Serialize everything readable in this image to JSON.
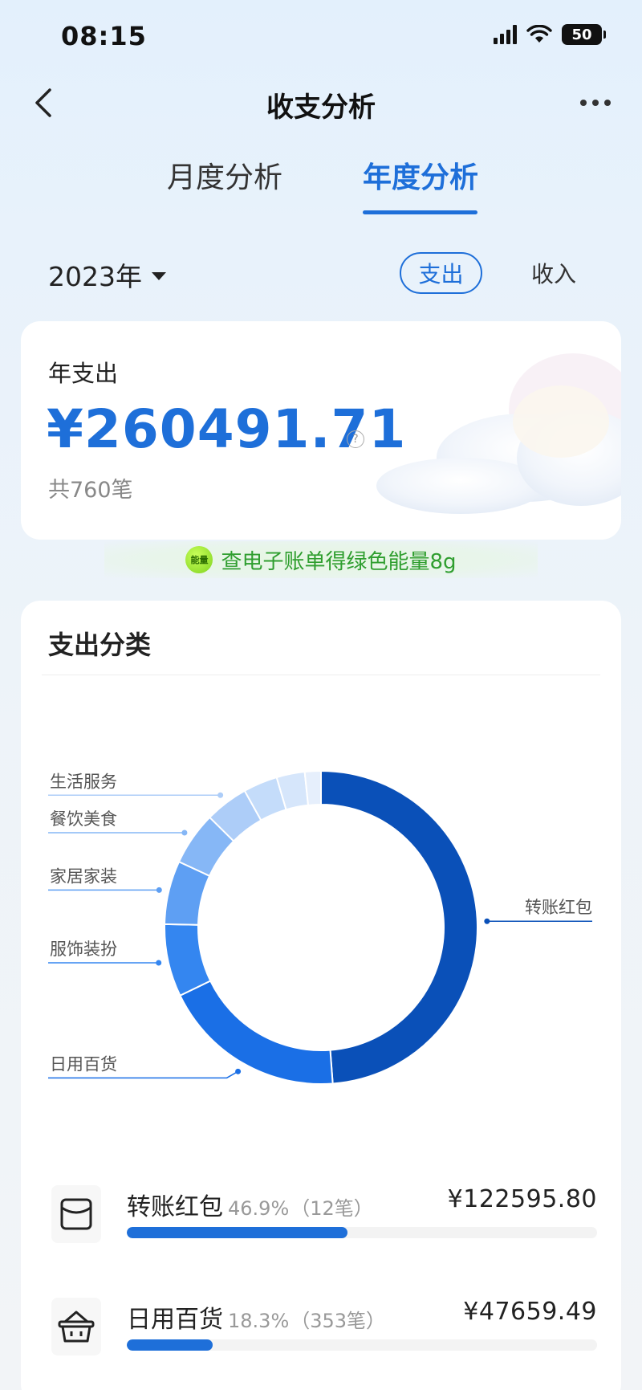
{
  "status": {
    "time": "08:15",
    "battery": "50"
  },
  "nav": {
    "title": "收支分析"
  },
  "tabs": {
    "month": "月度分析",
    "year": "年度分析"
  },
  "filter": {
    "year": "2023年",
    "expense": "支出",
    "income": "收入"
  },
  "summary": {
    "label": "年支出",
    "amount": "¥260491.71",
    "count": "共760笔",
    "help_icon": "question-circle-icon"
  },
  "energy": {
    "badge": "能量",
    "text": "查电子账单得绿色能量8g"
  },
  "category": {
    "title": "支出分类"
  },
  "chart_data": {
    "type": "pie",
    "variant": "donut",
    "title": "",
    "slices": [
      {
        "label": "转账红包",
        "value": 46.9,
        "color": "#0a50b8",
        "labeled": true
      },
      {
        "label": "日用百货",
        "value": 18.3,
        "color": "#1a6fe6",
        "labeled": true
      },
      {
        "label": "服饰装扮",
        "value": 7.2,
        "color": "#3486f0",
        "labeled": true
      },
      {
        "label": "家居家装",
        "value": 6.3,
        "color": "#5e9ff3",
        "labeled": true
      },
      {
        "label": "餐饮美食",
        "value": 5.3,
        "color": "#86b7f6",
        "labeled": true
      },
      {
        "label": "生活服务",
        "value": 4.3,
        "color": "#adcdf8",
        "labeled": true
      },
      {
        "label": "",
        "value": 3.4,
        "color": "#c4dcfa",
        "labeled": false
      },
      {
        "label": "",
        "value": 2.8,
        "color": "#d6e6fb",
        "labeled": false
      },
      {
        "label": "",
        "value": 1.6,
        "color": "#e6effc",
        "labeled": false
      }
    ]
  },
  "list": [
    {
      "name": "转账红包",
      "percent": "46.9%",
      "count": "（12笔）",
      "amount": "¥122595.80",
      "fill": 0.469,
      "icon": "envelope-icon"
    },
    {
      "name": "日用百货",
      "percent": "18.3%",
      "count": "（353笔）",
      "amount": "¥47659.49",
      "fill": 0.183,
      "icon": "basket-icon"
    }
  ]
}
